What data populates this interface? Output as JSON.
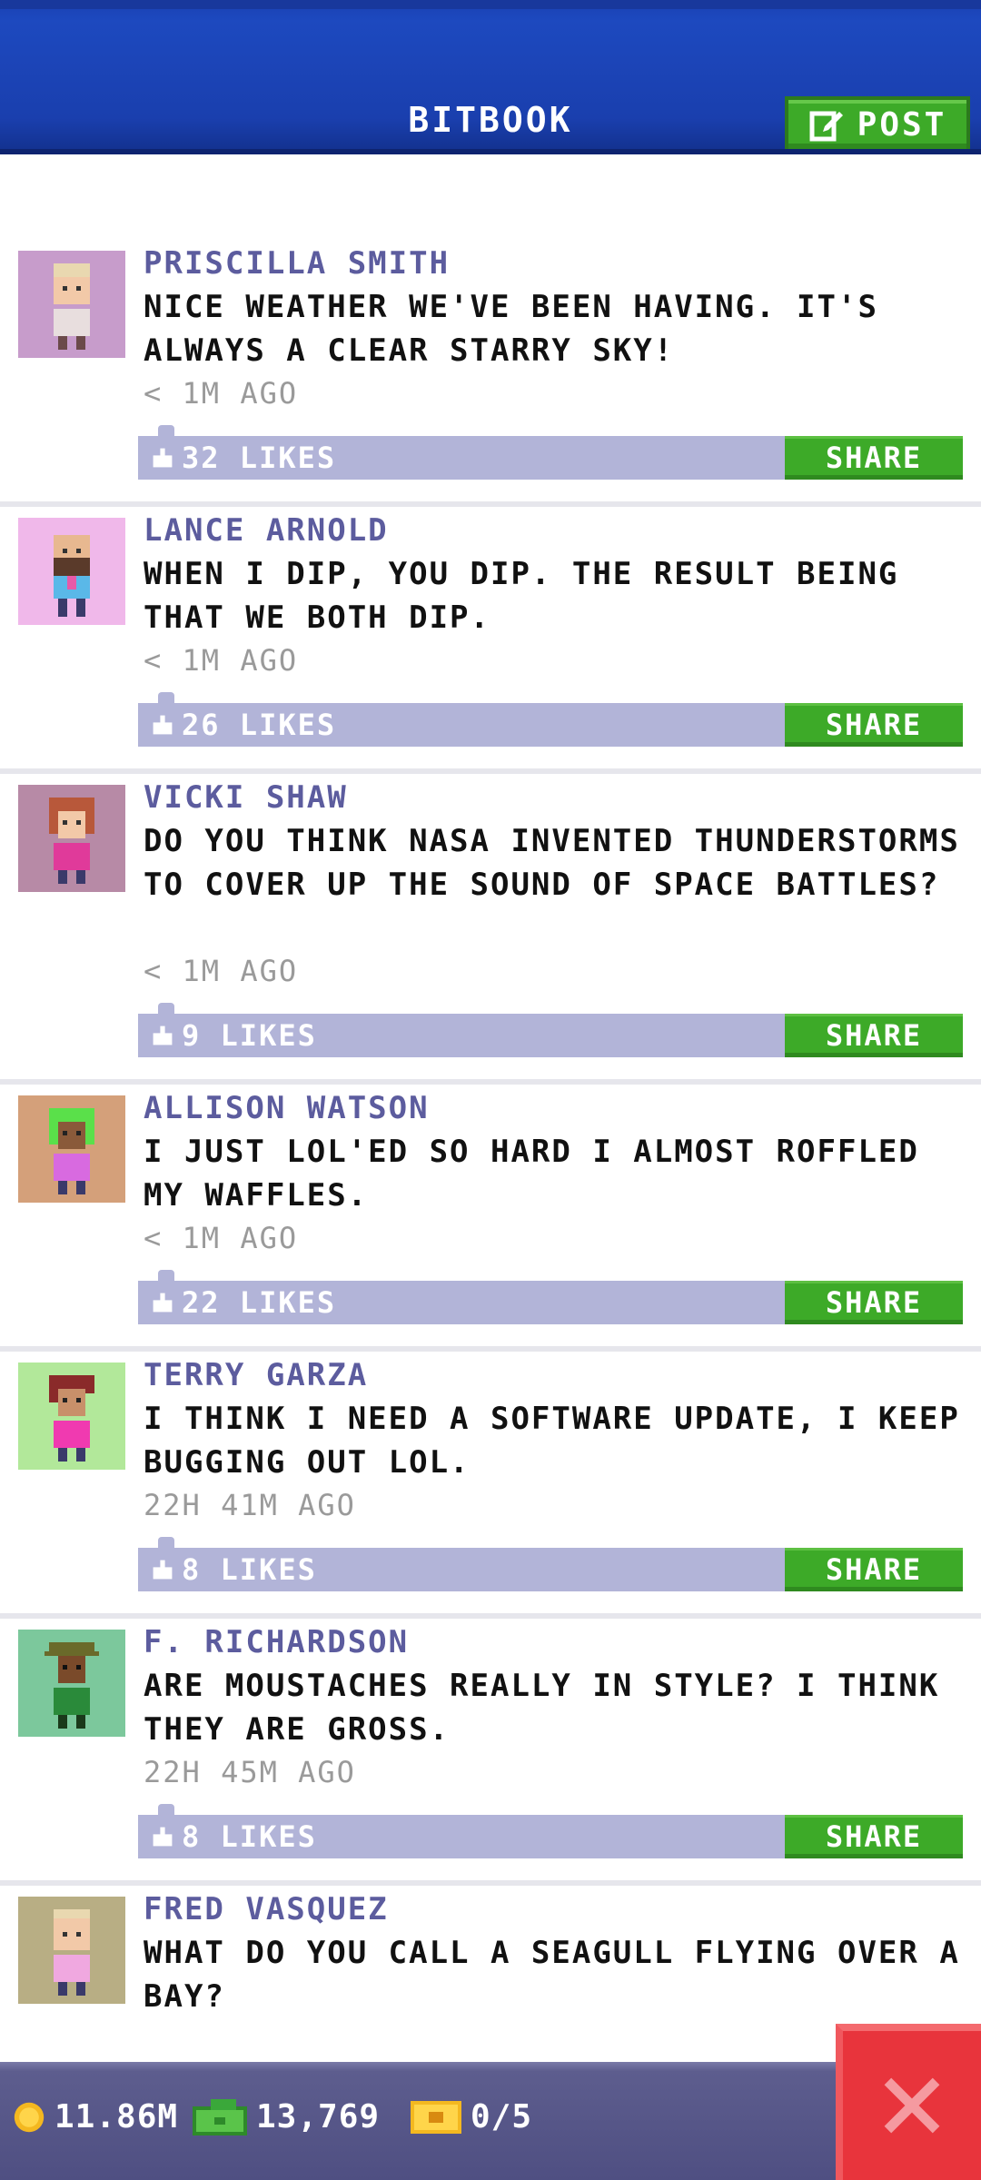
{
  "header": {
    "title": "BITBOOK",
    "post_label": "POST"
  },
  "posts": [
    {
      "author": "PRISCILLA SMITH",
      "message": "NICE WEATHER WE'VE BEEN HAVING. IT'S ALWAYS A CLEAR STARRY SKY!",
      "time": "< 1M AGO",
      "likes": "32 LIKES",
      "share": "SHARE",
      "avatar_bg": "#c79ccb"
    },
    {
      "author": "LANCE ARNOLD",
      "message": "WHEN I DIP, YOU DIP. THE RESULT BEING THAT WE BOTH DIP.",
      "time": "< 1M AGO",
      "likes": "26 LIKES",
      "share": "SHARE",
      "avatar_bg": "#f0b8ea"
    },
    {
      "author": "VICKI SHAW",
      "message": "DO YOU THINK NASA INVENTED THUNDERSTORMS TO COVER UP THE SOUND OF SPACE BATTLES?",
      "time": "< 1M AGO",
      "likes": "9 LIKES",
      "share": "SHARE",
      "avatar_bg": "#b78aa6"
    },
    {
      "author": "ALLISON WATSON",
      "message": "I JUST LOL'ED SO HARD I ALMOST ROFFLED MY WAFFLES.",
      "time": "< 1M AGO",
      "likes": "22 LIKES",
      "share": "SHARE",
      "avatar_bg": "#d4a07a"
    },
    {
      "author": "TERRY GARZA",
      "message": "I THINK I NEED A SOFTWARE UPDATE, I KEEP BUGGING OUT LOL.",
      "time": "22H 41M AGO",
      "likes": "8 LIKES",
      "share": "SHARE",
      "avatar_bg": "#b2e89a"
    },
    {
      "author": "F. RICHARDSON",
      "message": "ARE MOUSTACHES REALLY IN STYLE? I THINK THEY ARE GROSS.",
      "time": "22H 45M AGO",
      "likes": "8 LIKES",
      "share": "SHARE",
      "avatar_bg": "#7cc89c"
    },
    {
      "author": "FRED VASQUEZ",
      "message": "WHAT DO YOU CALL A SEAGULL FLYING OVER A BAY?",
      "time": "",
      "likes": "",
      "share": "",
      "avatar_bg": "#b8ae84"
    }
  ],
  "status_bar": {
    "coins": "11.86M",
    "bux": "13,769",
    "tickets": "0/5"
  },
  "colors": {
    "header_blue": "#1a3fae",
    "share_green": "#3daa28",
    "like_bar": "#b2b4d8",
    "author_purple": "#5c5c9e",
    "close_red": "#e8343c"
  }
}
